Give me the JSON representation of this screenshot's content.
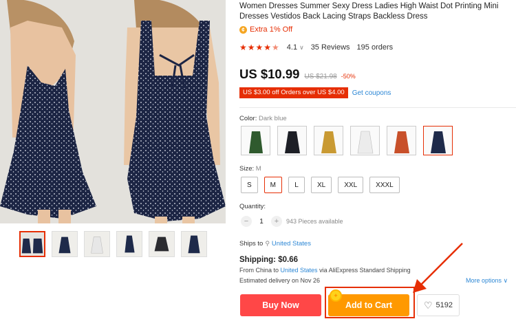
{
  "product": {
    "title": "Women Dresses Summer Sexy Dress Ladies High Waist Dot Printing Mini Dresses Vestidos Back Lacing Straps Backless Dress",
    "extra_offer": "Extra 1% Off",
    "rating_score": "4.1",
    "reviews": "35 Reviews",
    "orders": "195 orders",
    "price": "US $10.99",
    "old_price": "US $21.98",
    "discount": "-50%",
    "coupon_text": "US $3.00 off Orders over US $4.00",
    "get_coupons": "Get coupons",
    "stars": 4.1
  },
  "color": {
    "label": "Color:",
    "value": "Dark blue",
    "swatches": [
      {
        "name": "green",
        "hex": "#2f5a2e"
      },
      {
        "name": "black",
        "hex": "#1d1f26"
      },
      {
        "name": "mustard",
        "hex": "#c99a33"
      },
      {
        "name": "white",
        "hex": "#ececec"
      },
      {
        "name": "orange",
        "hex": "#c8502a"
      },
      {
        "name": "dark blue",
        "hex": "#1e2a4a"
      }
    ]
  },
  "size": {
    "label": "Size:",
    "value": "M",
    "options": [
      "S",
      "M",
      "L",
      "XL",
      "XXL",
      "XXXL"
    ]
  },
  "quantity": {
    "label": "Quantity:",
    "minus": "−",
    "plus": "+",
    "value": "1",
    "available": "943 Pieces available"
  },
  "shipping": {
    "ships_to_label": "Ships to",
    "ships_to": "United States",
    "title": "Shipping: $0.66",
    "from_prefix": "From China to ",
    "from_country": "United States",
    "from_suffix": " via AliExpress Standard Shipping",
    "delivery": "Estimated delivery on Nov 26",
    "more_options": "More options ∨"
  },
  "actions": {
    "buy_now": "Buy Now",
    "add_to_cart": "Add to Cart",
    "wishlist_count": "5192"
  },
  "colors": {
    "accent": "#e62e04",
    "buy_now": "#ff4747",
    "add_to_cart": "#ff9900",
    "link": "#2c87d5",
    "dress": "#1e2a4a"
  }
}
